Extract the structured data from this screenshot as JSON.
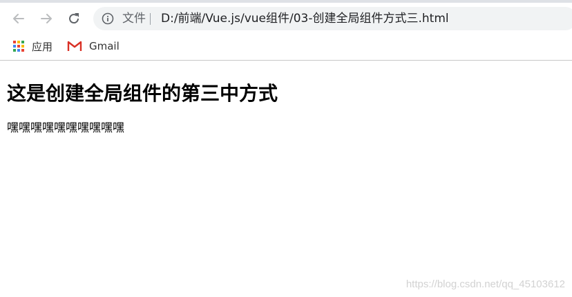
{
  "browser": {
    "secure_label": "文件",
    "url": "D:/前端/Vue.js/vue组件/03-创建全局组件方式三.html",
    "icons": {
      "back": "arrow-left-icon",
      "forward": "arrow-right-icon",
      "reload": "reload-icon",
      "info": "info-icon"
    }
  },
  "bookmarks": [
    {
      "label": "应用",
      "icon": "apps-grid-icon"
    },
    {
      "label": "Gmail",
      "icon": "gmail-icon"
    }
  ],
  "page": {
    "heading": "这是创建全局组件的第三中方式",
    "paragraph": "嘿嘿嘿嘿嘿嘿嘿嘿嘿嘿"
  },
  "watermark": "https://blog.csdn.net/qq_45103612",
  "colors": {
    "toolbar_bg": "#ffffff",
    "omnibox_bg": "#f1f3f4",
    "icon_grey": "#5f6368",
    "gmail_red": "#d93025"
  }
}
